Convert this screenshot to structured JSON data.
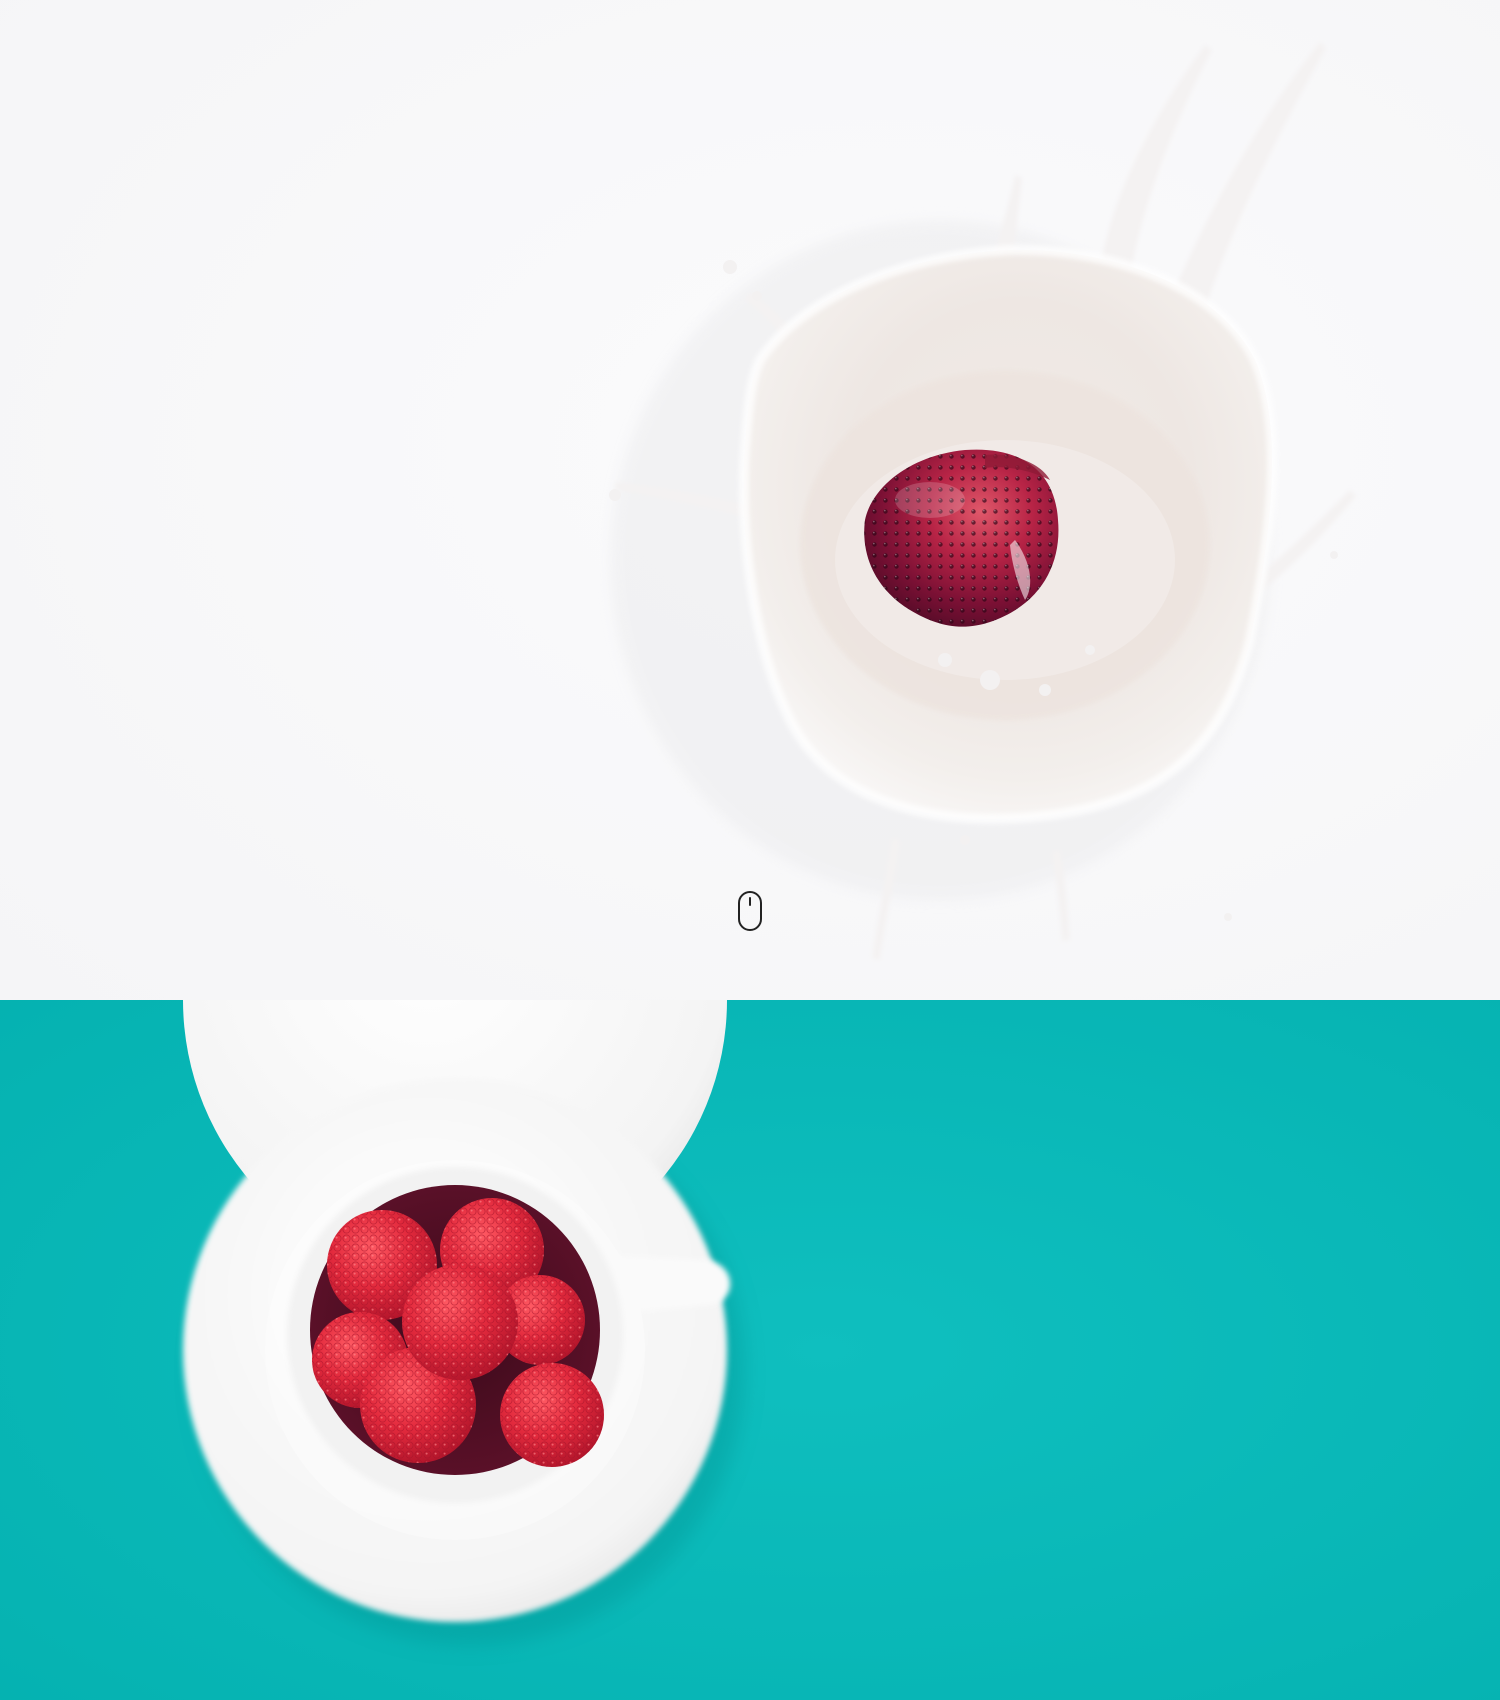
{
  "hero": {
    "background_color": "#f7f7f8",
    "photo_subject": "strawberry-milk-splash",
    "scroll_indicator_icon": "mouse-icon"
  },
  "feature": {
    "background_color": "#0ab7b7",
    "photo_subject": "raspberries-in-white-cup"
  },
  "colors": {
    "teal": "#0ab7b7",
    "milk": "#efe9e5",
    "strawberry": "#b81c3c",
    "raspberry": "#d9263b"
  }
}
